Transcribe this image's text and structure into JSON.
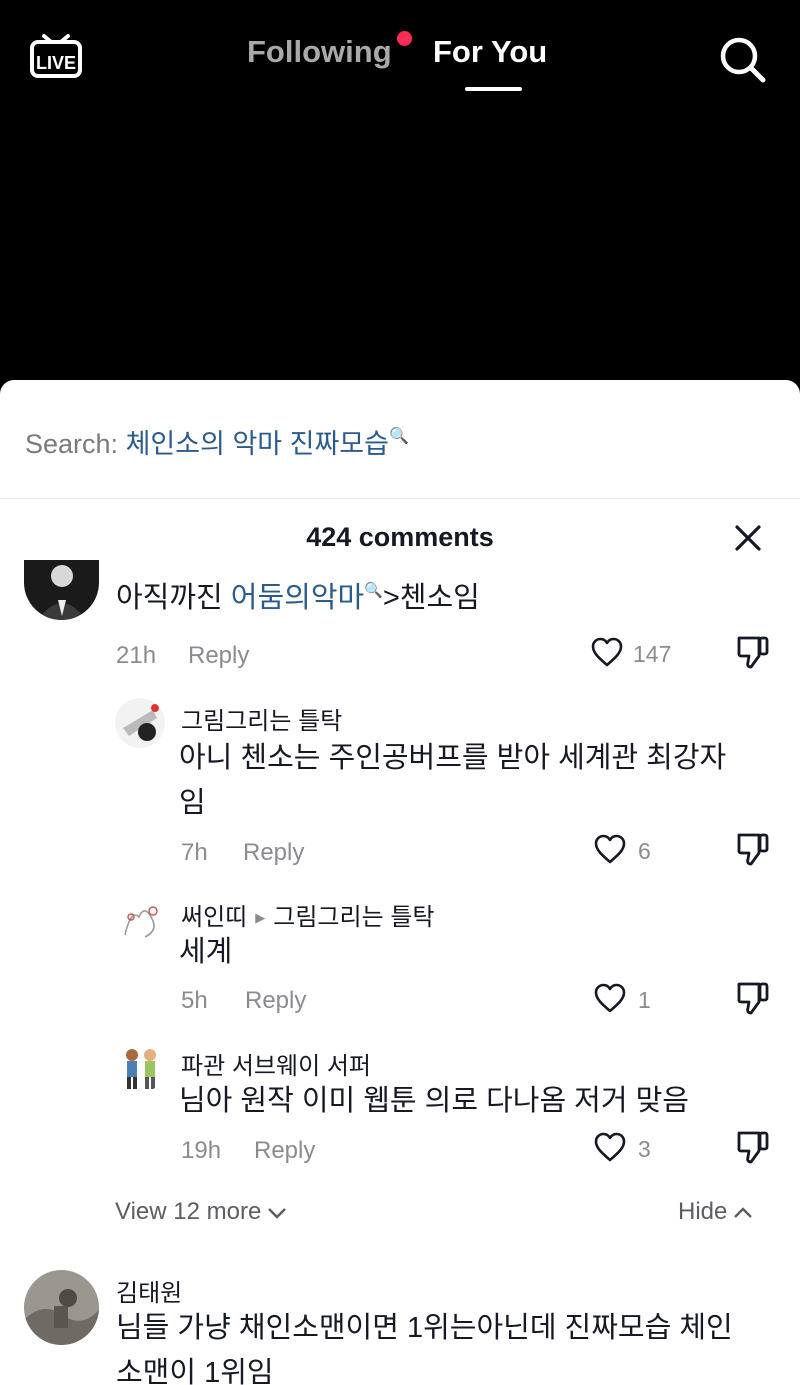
{
  "nav": {
    "live_label": "LIVE",
    "following_label": "Following",
    "foryou_label": "For You"
  },
  "search": {
    "label": "Search:",
    "term": "체인소의 악마 진짜모습"
  },
  "comments_header": {
    "count_label": "424 comments"
  },
  "comments": [
    {
      "text_before": "아직까진 ",
      "link": "어둠의악마",
      "text_after": ">첸소임",
      "time": "21h",
      "reply_label": "Reply",
      "likes": "147"
    },
    {
      "username": "그림그리는 틀탁",
      "line1": "아니 첸소는 주인공버프를 받아 세계관 최강자",
      "line2": "임",
      "time": "7h",
      "reply_label": "Reply",
      "likes": "6"
    },
    {
      "username": "써인띠",
      "reply_to": "그림그리는 틀탁",
      "text": "세계",
      "time": "5h",
      "reply_label": "Reply",
      "likes": "1"
    },
    {
      "username": "파관 서브웨이 서퍼",
      "text": "님아 원작 이미 웹툰 의로 다나옴 저거 맞음",
      "time": "19h",
      "reply_label": "Reply",
      "likes": "3"
    },
    {
      "username": "김태원",
      "line1": "님들 가냥 채인소맨이면 1위는아닌데 진짜모습 체인",
      "line2": "소맨이 1위임"
    }
  ],
  "thread": {
    "view_more_label": "View 12 more",
    "hide_label": "Hide"
  },
  "colors": {
    "accent_red": "#fe2c55",
    "link_blue": "#2a5a8e",
    "muted_gray": "#8a8b91"
  }
}
